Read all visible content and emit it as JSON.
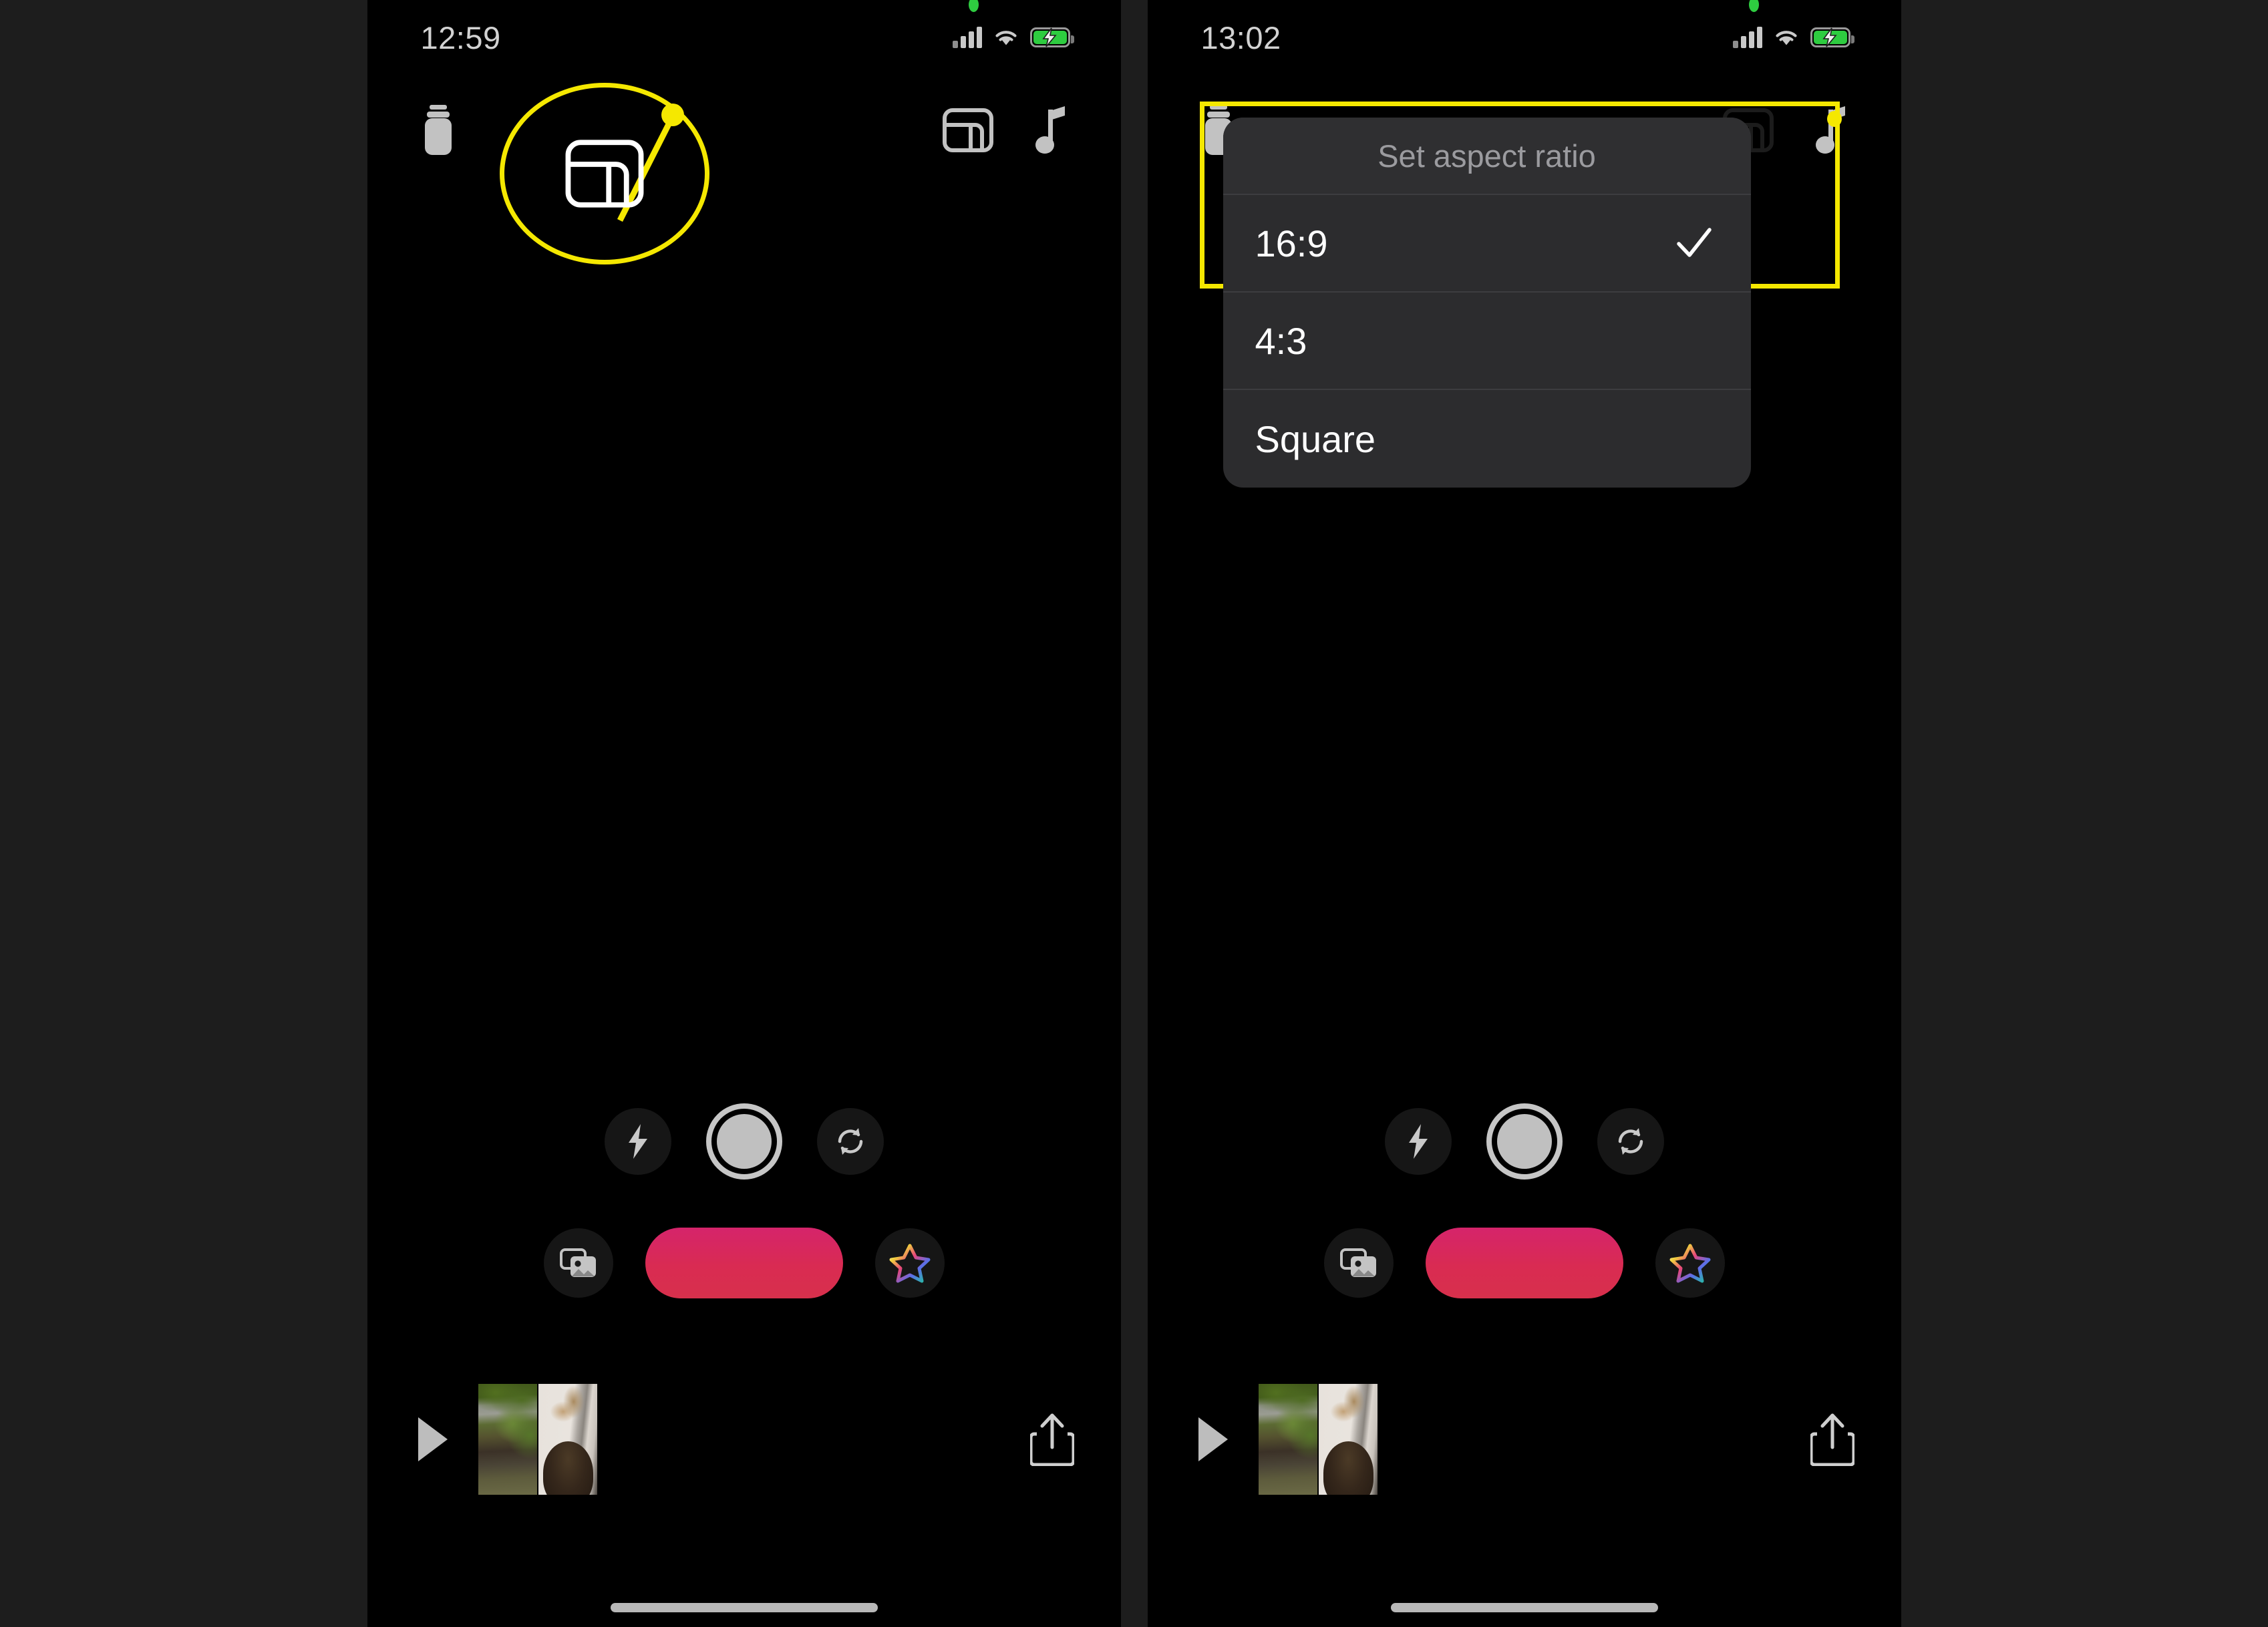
{
  "theme": {
    "page_background": "#1d1d1d",
    "screen_background": "#000000",
    "highlight_yellow": "#f5e800",
    "record_red": "#d92b52",
    "sheet_background": "#2c2c2e",
    "status_green": "#2ecc40"
  },
  "panels": [
    {
      "id": "left",
      "status_bar": {
        "time": "12:59",
        "icons": [
          "cellular-signal-icon",
          "wifi-icon",
          "battery-charging-icon"
        ]
      },
      "toolbar": {
        "filter_label": "Filters",
        "aspect_ratio_label": "Aspect ratio",
        "music_label": "Music"
      },
      "callout": {
        "kind": "magnifier-circle",
        "target_icon": "aspect-ratio-icon",
        "color": "#f5e800"
      },
      "camera_controls": {
        "flash_label": "Flash",
        "shutter_label": "Capture",
        "flip_label": "Flip camera"
      },
      "action_row": {
        "gallery_label": "Gallery",
        "record_label": "Record",
        "effects_label": "Effects"
      },
      "timeline": {
        "play_label": "Play",
        "share_label": "Share",
        "clips": [
          {
            "name": "balcony-street-clip",
            "description": "Outdoor balcony view with green trees and street"
          },
          {
            "name": "dogs-on-bed-clip",
            "description": "Tan chihuahua on white bed with dark dog"
          }
        ]
      }
    },
    {
      "id": "right",
      "status_bar": {
        "time": "13:02",
        "icons": [
          "cellular-signal-icon",
          "wifi-icon",
          "battery-charging-icon"
        ]
      },
      "toolbar": {
        "filter_label": "Filters",
        "aspect_ratio_label": "Aspect ratio",
        "music_label": "Music"
      },
      "dialog": {
        "title": "Set aspect ratio",
        "options": [
          {
            "label": "16:9",
            "selected": true
          },
          {
            "label": "4:3",
            "selected": false
          },
          {
            "label": "Square",
            "selected": false
          }
        ],
        "checkmark_icon": "check-icon"
      },
      "camera_controls": {
        "flash_label": "Flash",
        "shutter_label": "Capture",
        "flip_label": "Flip camera"
      },
      "action_row": {
        "gallery_label": "Gallery",
        "record_label": "Record",
        "effects_label": "Effects"
      },
      "timeline": {
        "play_label": "Play",
        "share_label": "Share",
        "clips": [
          {
            "name": "balcony-street-clip",
            "description": "Outdoor balcony view with green trees and street"
          },
          {
            "name": "dogs-on-bed-clip",
            "description": "Tan chihuahua on white bed with dark dog"
          }
        ]
      }
    }
  ]
}
